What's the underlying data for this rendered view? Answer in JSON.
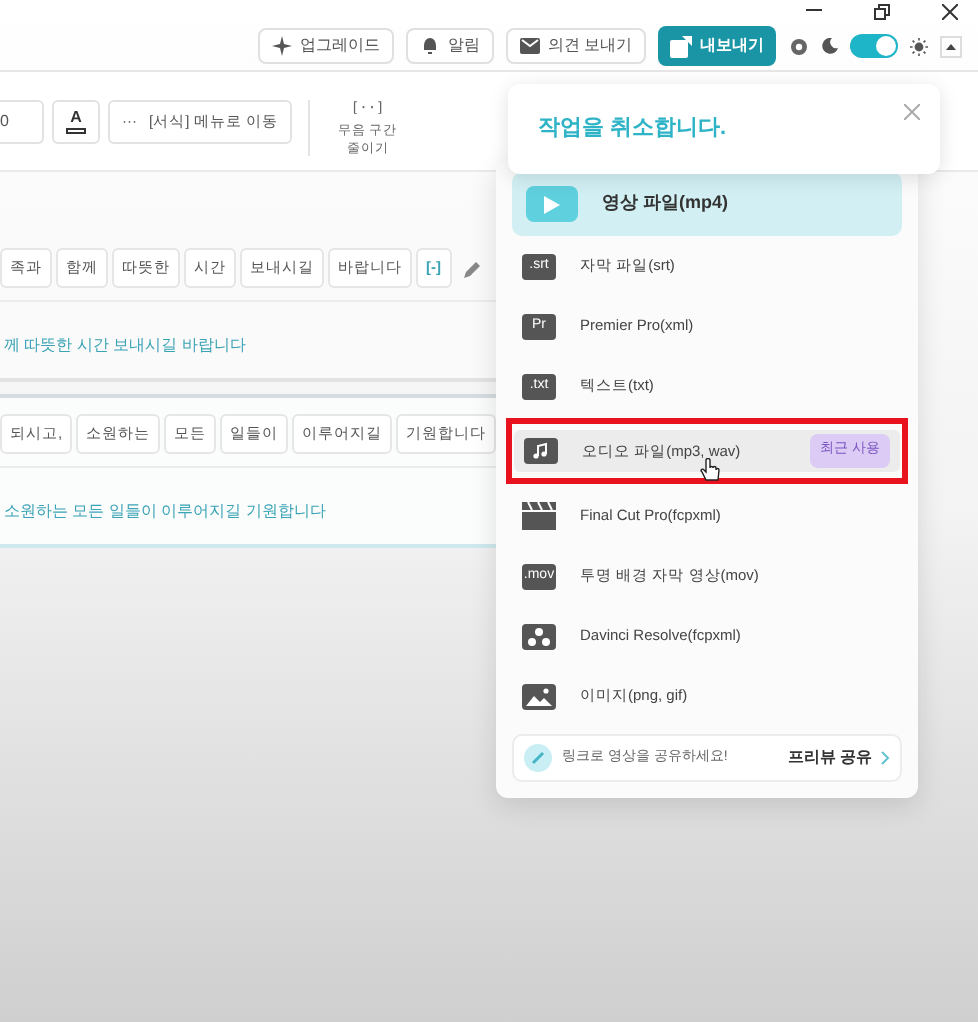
{
  "topbar": {
    "buttons": [
      {
        "label": "업그레이드",
        "kind": "sparkle",
        "active": false
      },
      {
        "label": "알림",
        "kind": "bell",
        "active": false
      },
      {
        "label": "의견 보내기",
        "kind": "mail",
        "active": false
      },
      {
        "label": "내보내기",
        "kind": "export",
        "active": true
      }
    ],
    "theme_toggle": {
      "on": true
    }
  },
  "toolbar": {
    "size_value": "0",
    "color_button": "A",
    "format_button": {
      "icon": "···",
      "label": "[서식] 메뉴로 이동"
    },
    "silence_tool": {
      "icon": "[··]",
      "label": "무음 구간 줄이기"
    }
  },
  "subtitles": [
    {
      "words": [
        "족과",
        "함께",
        "따뜻한",
        "시간",
        "보내시길",
        "바랍니다",
        "[-]"
      ],
      "text": "께 따뜻한 시간 보내시길 바랍니다",
      "active": false
    },
    {
      "words": [
        "되시고,",
        "소원하는",
        "모든",
        "일들이",
        "이루어지길",
        "기원합니다"
      ],
      "text": "소원하는 모든 일들이 이루어지길 기원합니다",
      "active": true
    }
  ],
  "toast": {
    "message": "작업을 취소합니다."
  },
  "export_menu": {
    "items": [
      {
        "kind": "play",
        "label": "영상 파일(mp4)",
        "selected": true,
        "highlighted": false
      },
      {
        "kind": "tag",
        "tag": ".srt",
        "label": "자막 파일(srt)",
        "selected": false,
        "highlighted": false
      },
      {
        "kind": "tag",
        "tag": "Pr",
        "label": "Premier Pro(xml)",
        "selected": false,
        "highlighted": false
      },
      {
        "kind": "tag",
        "tag": ".txt",
        "label": "텍스트(txt)",
        "selected": false,
        "highlighted": false
      },
      {
        "kind": "music",
        "label": "오디오 파일(mp3, wav)",
        "badge": "최근 사용",
        "selected": false,
        "highlighted": true
      },
      {
        "kind": "clapper",
        "label": "Final Cut Pro(fcpxml)",
        "selected": false,
        "highlighted": false
      },
      {
        "kind": "tag",
        "tag": ".mov",
        "label": "투명 배경 자막 영상(mov)",
        "selected": false,
        "highlighted": false
      },
      {
        "kind": "nodes",
        "label": "Davinci Resolve(fcpxml)",
        "selected": false,
        "highlighted": false
      },
      {
        "kind": "image",
        "label": "이미지(png, gif)",
        "selected": false,
        "highlighted": false
      }
    ],
    "share": {
      "text": "링크로 영상을 공유하세요!",
      "action": "프리뷰 공유"
    }
  }
}
